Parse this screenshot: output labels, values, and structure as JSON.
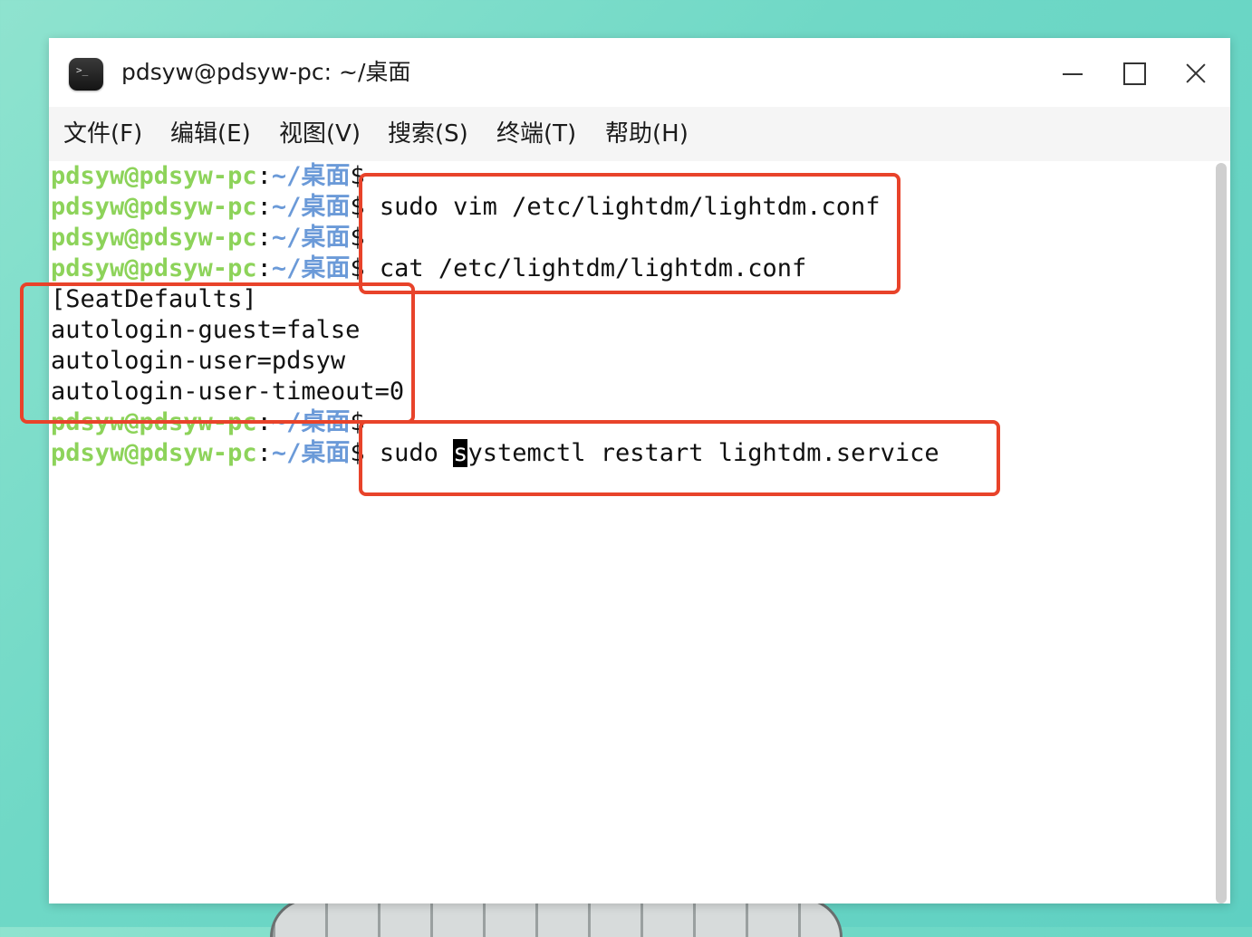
{
  "window": {
    "title": "pdsyw@pdsyw-pc: ~/桌面",
    "icon": "terminal-icon",
    "controls": [
      "minimize-icon",
      "maximize-icon",
      "close-icon"
    ]
  },
  "menu": [
    {
      "label": "文件(F)"
    },
    {
      "label": "编辑(E)"
    },
    {
      "label": "视图(V)"
    },
    {
      "label": "搜索(S)"
    },
    {
      "label": "终端(T)"
    },
    {
      "label": "帮助(H)"
    }
  ],
  "prompt": {
    "user": "pdsyw@pdsyw-pc",
    "colon": ":",
    "path": "~/桌面",
    "dollar": "$"
  },
  "terminal": {
    "lines": [
      {
        "type": "prompt",
        "cmd": ""
      },
      {
        "type": "prompt",
        "cmd": " sudo vim /etc/lightdm/lightdm.conf"
      },
      {
        "type": "prompt",
        "cmd": ""
      },
      {
        "type": "prompt",
        "cmd": " cat /etc/lightdm/lightdm.conf"
      },
      {
        "type": "output",
        "text": "[SeatDefaults]"
      },
      {
        "type": "output",
        "text": "autologin-guest=false"
      },
      {
        "type": "output",
        "text": "autologin-user=pdsyw"
      },
      {
        "type": "output",
        "text": "autologin-user-timeout=0"
      },
      {
        "type": "prompt",
        "cmd": ""
      },
      {
        "type": "prompt",
        "cmd_pre": " sudo ",
        "cursor_char": "s",
        "cmd_post": "ystemctl restart lightdm.service"
      }
    ]
  },
  "colors": {
    "prompt_user": "#8dd35a",
    "prompt_path": "#6b9ad8",
    "highlight_box": "#e8432a",
    "background": "#6fd8c6"
  }
}
